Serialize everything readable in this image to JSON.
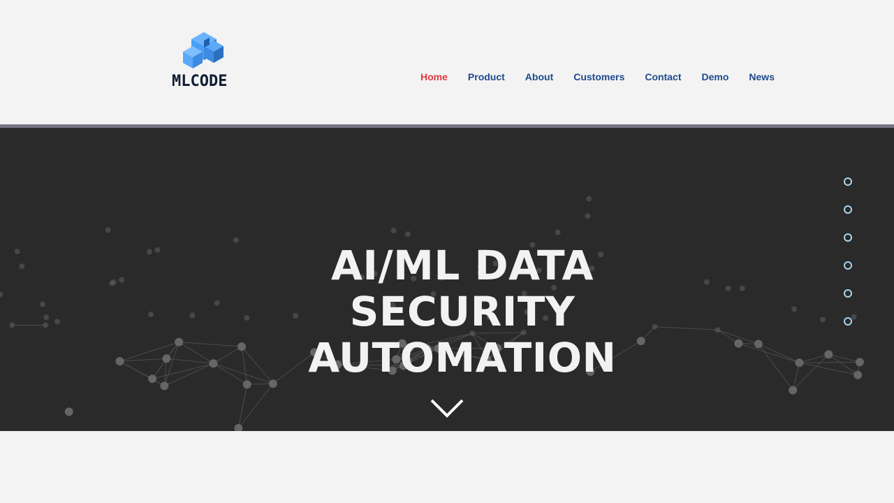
{
  "brand": {
    "name": "MLCODE",
    "colors": {
      "primary_blue": "#4a9ef5",
      "dark": "#0f1d33"
    },
    "logo_icon": "cubes-logo-icon"
  },
  "nav": {
    "items": [
      {
        "label": "Home",
        "active": true
      },
      {
        "label": "Product",
        "active": false
      },
      {
        "label": "About",
        "active": false
      },
      {
        "label": "Customers",
        "active": false
      },
      {
        "label": "Contact",
        "active": false
      },
      {
        "label": "Demo",
        "active": false
      },
      {
        "label": "News",
        "active": false
      }
    ],
    "colors": {
      "default": "#1e4a8c",
      "active": "#e03a3e"
    }
  },
  "hero": {
    "title_lines": [
      "AI/ML DATA",
      "SECURITY",
      "AUTOMATION"
    ],
    "scroll_icon": "chevron-down-icon",
    "background_color": "#2a2a2a"
  },
  "section_nav": {
    "count": 6,
    "dot_color": "#a9d6ee"
  }
}
